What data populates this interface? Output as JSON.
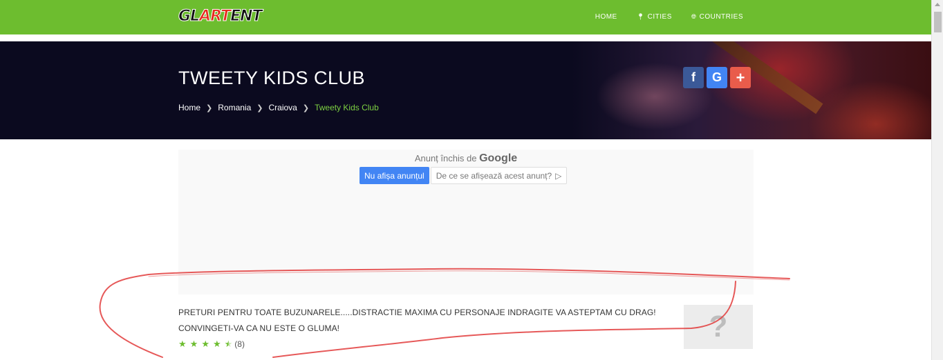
{
  "header": {
    "logo_part1": "GL",
    "logo_part2": "ART",
    "logo_part3": "ENT",
    "nav": [
      {
        "label": "HOME",
        "icon": ""
      },
      {
        "label": "CITIES",
        "icon": "map-marker-icon"
      },
      {
        "label": "COUNTRIES",
        "icon": "globe-icon"
      }
    ]
  },
  "hero": {
    "title": "TWEETY KIDS CLUB",
    "breadcrumb": [
      "Home",
      "Romania",
      "Craiova",
      "Tweety Kids Club"
    ],
    "social": [
      "f",
      "G",
      "+"
    ]
  },
  "ad": {
    "closed_text": "Anunț închis de",
    "closed_brand": "Google",
    "hide_button": "Nu afișa anunțul",
    "why_button": "De ce se afișează acest anunț?"
  },
  "listing": {
    "description": "PRETURI PENTRU TOATE BUZUNARELE.....DISTRACTIE MAXIMA CU PERSONAJE INDRAGITE VA ASTEPTAM CU DRAG! CONVINGETI-VA CA NU ESTE O GLUMA!",
    "rating_value": 4.5,
    "rating_max": 5,
    "rating_count": "(8)",
    "thumb_glyph": "?"
  },
  "colors": {
    "brand_green": "#6dbd2f",
    "hero_bg": "#0b0a1f",
    "annotation_red": "#e23b3b"
  }
}
